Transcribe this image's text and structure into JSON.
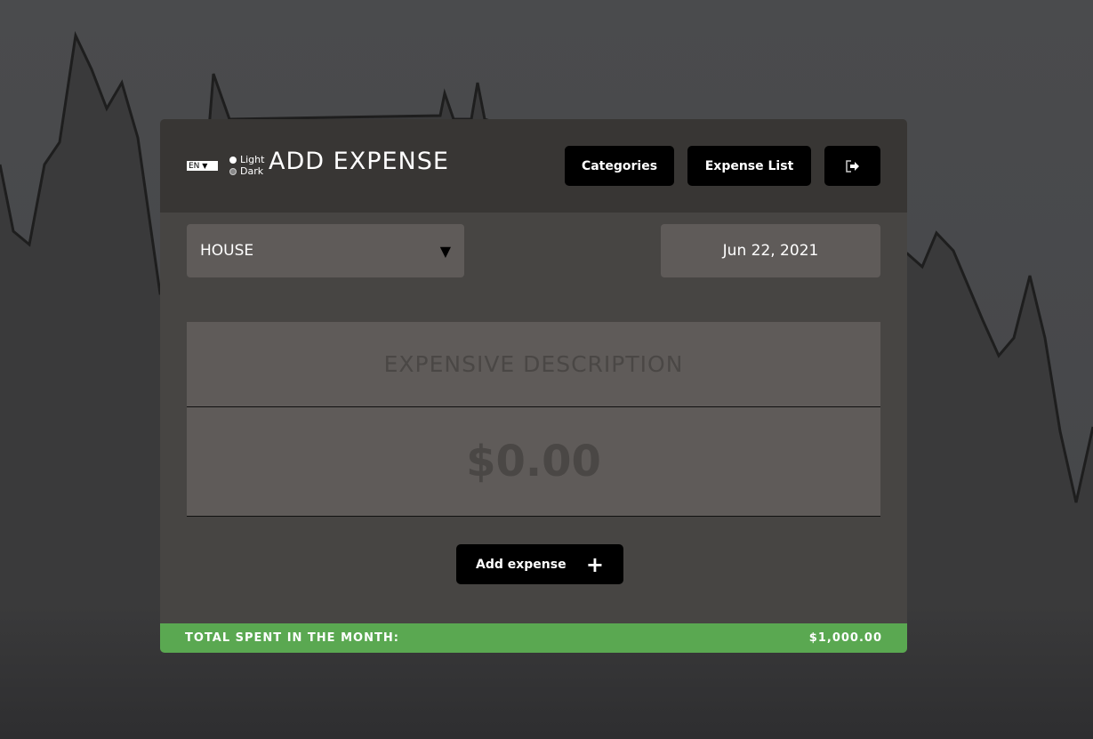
{
  "header": {
    "language": "EN",
    "theme_options": [
      "Light",
      "Dark"
    ],
    "title": "ADD EXPENSE",
    "categories_label": "Categories",
    "expense_list_label": "Expense List",
    "logout_icon": "sign-out-icon"
  },
  "form": {
    "category": "HOUSE",
    "date": "Jun 22, 2021",
    "description_placeholder": "EXPENSIVE DESCRIPTION",
    "amount_placeholder": "$0.00",
    "add_label": "Add expense",
    "add_icon": "plus-icon"
  },
  "footer": {
    "total_label": "TOTAL SPENT IN THE MONTH:",
    "total_value": "$1,000.00",
    "color": "#5aa851"
  }
}
